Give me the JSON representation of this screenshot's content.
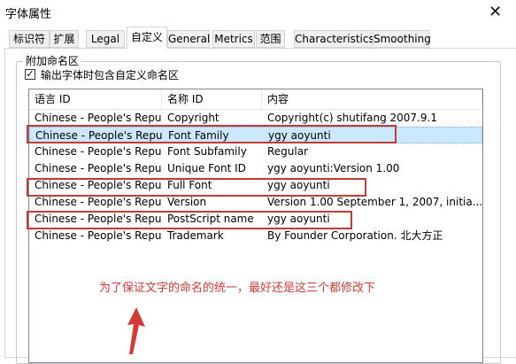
{
  "window": {
    "title": "字体属性",
    "close_glyph": "✕"
  },
  "tabs": [
    {
      "label": "标识符",
      "active": false
    },
    {
      "label": "扩展",
      "active": false
    },
    {
      "label": "Legal",
      "active": false
    },
    {
      "label": "自定义",
      "active": true
    },
    {
      "label": "General",
      "active": false
    },
    {
      "label": "Metrics",
      "active": false
    },
    {
      "label": "范围",
      "active": false
    },
    {
      "label": "Characteristics",
      "active": false
    },
    {
      "label": "Smoothing",
      "active": false
    }
  ],
  "group": {
    "legend": "附加命名区"
  },
  "checkbox": {
    "label": "输出字体时包含自定义命名区",
    "checked": true,
    "check_glyph": "✓"
  },
  "list": {
    "columns": [
      "语言 ID",
      "名称 ID",
      "内容"
    ],
    "rows": [
      {
        "lang": "Chinese - People's Repu...",
        "name": "Copyright",
        "content": "Copyright(c) shutifang 2007.9.1",
        "selected": false
      },
      {
        "lang": "Chinese - People's Repu...",
        "name": "Font Family",
        "content": "ygy aoyunti",
        "selected": true
      },
      {
        "lang": "Chinese - People's Repu...",
        "name": "Font Subfamily",
        "content": "Regular",
        "selected": false
      },
      {
        "lang": "Chinese - People's Repu...",
        "name": "Unique Font ID",
        "content": "ygy aoyunti:Version 1.00",
        "selected": false
      },
      {
        "lang": "Chinese - People's Repu...",
        "name": "Full Font",
        "content": "ygy aoyunti",
        "selected": false
      },
      {
        "lang": "Chinese - People's Repu...",
        "name": "Version",
        "content": "Version 1.00 September 1, 2007, initia...",
        "selected": false
      },
      {
        "lang": "Chinese - People's Repu...",
        "name": "PostScript name",
        "content": "ygy aoyunti",
        "selected": false
      },
      {
        "lang": "Chinese - People's Repu...",
        "name": "Trademark",
        "content": "By Founder Corporation. 北大方正",
        "selected": false
      }
    ]
  },
  "annotation": {
    "text": "为了保证文字的命名的统一，最好还是这三个都修改下",
    "color": "#d23a33",
    "icon": "arrow-up-icon"
  }
}
